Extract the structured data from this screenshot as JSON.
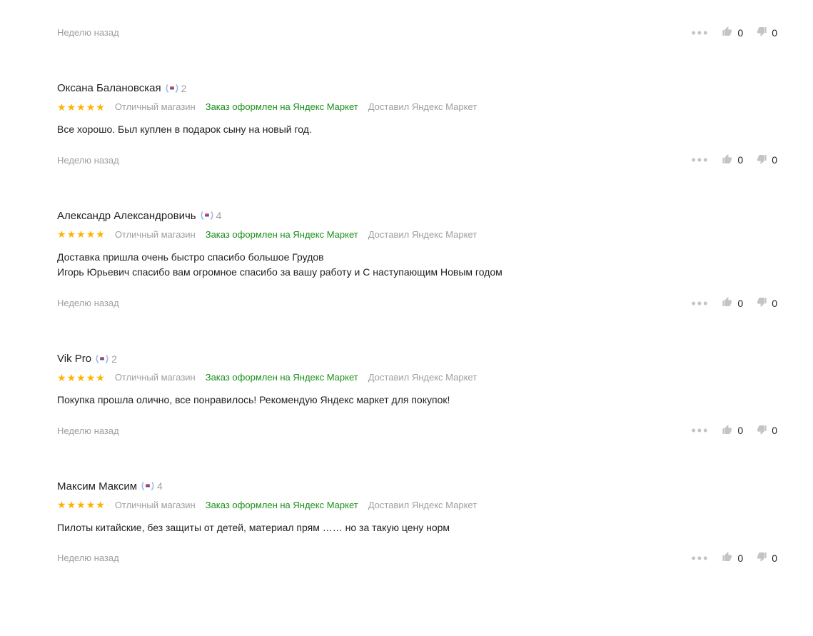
{
  "orphan": {
    "time_ago": "Неделю назад",
    "actions": {
      "likes": "0",
      "dislikes": "0"
    }
  },
  "reviews": [
    {
      "author": "Оксана Балановская",
      "level": "2",
      "rating": 5,
      "shop_summary": "Отличный магазин",
      "order_info": "Заказ оформлен на Яндекс Маркет",
      "delivery_info": "Доставил Яндекс Маркет",
      "body": "Все хорошо. Был куплен в подарок сыну на новый год.",
      "time_ago": "Неделю назад",
      "actions": {
        "likes": "0",
        "dislikes": "0"
      }
    },
    {
      "author": "Александр Александровичь",
      "level": "4",
      "rating": 5,
      "shop_summary": "Отличный магазин",
      "order_info": "Заказ оформлен на Яндекс Маркет",
      "delivery_info": "Доставил Яндекс Маркет",
      "body": "Доставка пришла очень быстро спасибо большое Грудов\nИгорь Юрьевич спасибо вам огромное спасибо за вашу работу и С наступающим Новым годом",
      "time_ago": "Неделю назад",
      "actions": {
        "likes": "0",
        "dislikes": "0"
      }
    },
    {
      "author": "Vik Pro",
      "level": "2",
      "rating": 5,
      "shop_summary": "Отличный магазин",
      "order_info": "Заказ оформлен на Яндекс Маркет",
      "delivery_info": "Доставил Яндекс Маркет",
      "body": "Покупка прошла олично, все понравилось! Рекомендую Яндекс маркет для покупок!",
      "time_ago": "Неделю назад",
      "actions": {
        "likes": "0",
        "dislikes": "0"
      }
    },
    {
      "author": "Максим Максим",
      "level": "4",
      "rating": 5,
      "shop_summary": "Отличный магазин",
      "order_info": "Заказ оформлен на Яндекс Маркет",
      "delivery_info": "Доставил Яндекс Маркет",
      "body": "Пилоты китайские, без защиты от детей, материал прям …… но за такую цену норм",
      "time_ago": "Неделю назад",
      "actions": {
        "likes": "0",
        "dislikes": "0"
      }
    }
  ]
}
